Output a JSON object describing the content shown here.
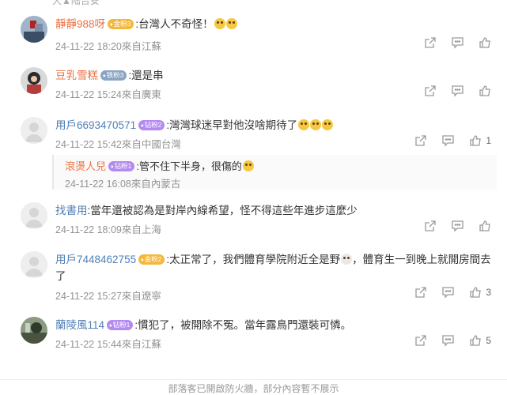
{
  "top_clip": "大▲陆台安",
  "footer_note": "部落客已開啟防火牆，部分內容暫不展示",
  "comments": [
    {
      "name": "靜靜988呀",
      "badge": "金粉3",
      "badge_type": "gold",
      "text": ":台灣人不奇怪！",
      "meta": "24-11-22 18:20來自江蘇",
      "likes": ""
    },
    {
      "name": "豆乳雪糕",
      "badge": "铁粉3",
      "badge_type": "iron",
      "text": ":還是串",
      "meta": "24-11-22 15:24來自廣東",
      "likes": ""
    },
    {
      "name": "用戶6693470571",
      "badge": "钻粉2",
      "badge_type": "dia",
      "text": ":灣灣球迷早對他沒啥期待了",
      "meta": "24-11-22 15:42來自中國台灣",
      "likes": "1"
    },
    {
      "name": "找書用",
      "badge": "",
      "badge_type": "",
      "text": ":當年還被認為是對岸內線希望，怪不得這些年進步這麼少",
      "meta": "24-11-22 18:09來自上海",
      "likes": ""
    },
    {
      "name": "用戶7448462755",
      "badge": "金粉2",
      "badge_type": "gold",
      "text": ":太正常了，我們體育學院附近全是野",
      "text2": "，體育生一到晚上就開房間去",
      "text3": "了",
      "meta": "24-11-22 15:27來自遼寧",
      "likes": "3"
    },
    {
      "name": "蘭陵風114",
      "badge": "钻粉1",
      "badge_type": "dia",
      "text": ":慣犯了，被開除不冤。當年露鳥門還裝可憐。",
      "meta": "24-11-22 15:44來自江蘇",
      "likes": "5"
    }
  ],
  "reply": {
    "name": "滾燙人兒",
    "badge": "钻粉1",
    "text": ":管不住下半身，很傷的",
    "meta": "24-11-22 16:08來自內蒙古"
  }
}
